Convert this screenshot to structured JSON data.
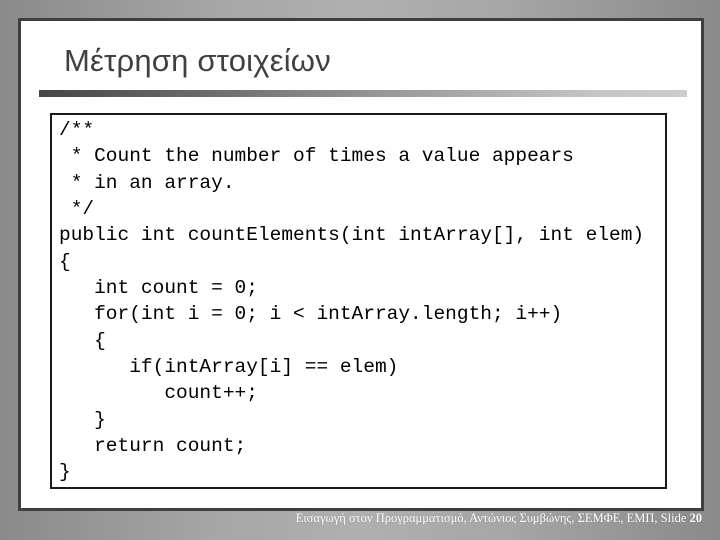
{
  "slide": {
    "title": "Μέτρηση στοιχείων",
    "code_lines": [
      "/**",
      " * Count the number of times a value appears",
      " * in an array.",
      " */",
      "public int countElements(int intArray[], int elem)",
      "{",
      "   int count = 0;",
      "   for(int i = 0; i < intArray.length; i++)",
      "   {",
      "      if(intArray[i] == elem)",
      "         count++;",
      "   }",
      "   return count;",
      "}"
    ]
  },
  "footer": {
    "text": "Εισαγωγή στον Προγραμματισμό, Αντώνιος Συμβώνης, ΣΕΜΦΕ, ΕΜΠ, Slide ",
    "slide_number": "20"
  },
  "colors": {
    "title": "#404040",
    "panel_border": "#3f3f3f",
    "code_border": "#1a1a1a",
    "footer_text": "#ffffff"
  }
}
